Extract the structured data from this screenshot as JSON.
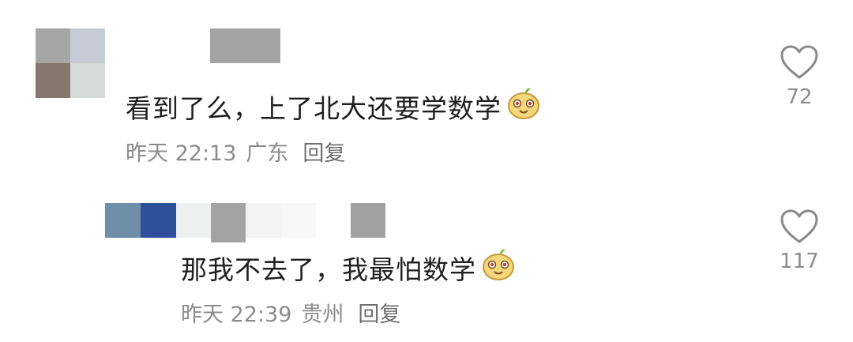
{
  "comments": [
    {
      "text": "看到了么，上了北大还要学数学",
      "time": "昨天 22:13",
      "location": "广东",
      "reply_label": "回复",
      "likes": "72",
      "emoji_icon": "smiling-bean-emoji"
    },
    {
      "text": "那我不去了，我最怕数学",
      "time": "昨天 22:39",
      "location": "贵州",
      "reply_label": "回复",
      "likes": "117",
      "emoji_icon": "smiling-bean-emoji"
    }
  ],
  "colors": {
    "text": "#1f1f1f",
    "meta": "#8c8c8c",
    "heart_outline": "#8a8a8a",
    "emoji_face": "#f5d97a"
  }
}
